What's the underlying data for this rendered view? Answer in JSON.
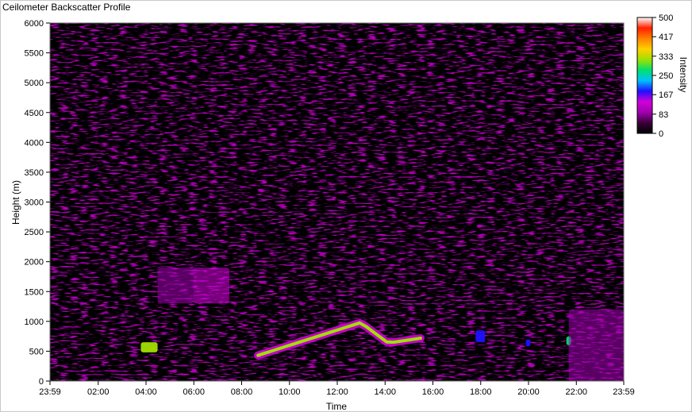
{
  "chart_data": {
    "type": "heatmap",
    "title": "Ceilometer Backscatter Profile",
    "xlabel": "Time",
    "ylabel": "Height (m)",
    "colorbar_label": "Intensity",
    "x_ticks": [
      "23:59",
      "02:00",
      "04:00",
      "06:00",
      "08:00",
      "10:00",
      "12:00",
      "14:00",
      "16:00",
      "18:00",
      "20:00",
      "22:00",
      "23:59"
    ],
    "x_tick_hours": [
      0,
      2.017,
      4.017,
      6.017,
      8.017,
      10.017,
      12.017,
      14.017,
      16.017,
      18.017,
      20.017,
      22.017,
      24
    ],
    "xlim_hours": [
      0,
      24
    ],
    "y_ticks": [
      0,
      500,
      1000,
      1500,
      2000,
      2500,
      3000,
      3500,
      4000,
      4500,
      5000,
      5500,
      6000
    ],
    "ylim": [
      0,
      6000
    ],
    "colorbar_ticks": [
      0,
      83,
      167,
      250,
      333,
      417,
      500
    ],
    "colorbar_range": [
      0,
      500
    ],
    "colormap": [
      "#000000",
      "#3a003a",
      "#a000b0",
      "#d000d8",
      "#2010ff",
      "#00c0ff",
      "#00e070",
      "#a0e000",
      "#ffd000",
      "#ff8000",
      "#ff2000",
      "#ffffff"
    ],
    "background_color": "#000000",
    "features": [
      {
        "name": "low cloud layer early",
        "hours": [
          3.8,
          4.5
        ],
        "height_m": [
          480,
          650
        ],
        "intensity": 300
      },
      {
        "name": "aerosol plume 04:30-06:00",
        "hours": [
          4.5,
          6.0
        ],
        "height_m": [
          1300,
          1900
        ],
        "intensity": 110
      },
      {
        "name": "aerosol plume 06:00-07:30",
        "hours": [
          6.0,
          7.5
        ],
        "height_m": [
          1300,
          1900
        ],
        "intensity": 120
      },
      {
        "name": "main cloud base arc",
        "hours": [
          8.7,
          15.5
        ],
        "height_m": [
          420,
          1050
        ],
        "intensity": 330
      },
      {
        "name": "isolated cloud 18:00",
        "hours": [
          17.8,
          18.2
        ],
        "height_m": [
          650,
          850
        ],
        "intensity": 200
      },
      {
        "name": "isolated cloud 20:00",
        "hours": [
          19.9,
          20.1
        ],
        "height_m": [
          580,
          700
        ],
        "intensity": 200
      },
      {
        "name": "cloud 21:40",
        "hours": [
          21.6,
          21.8
        ],
        "height_m": [
          600,
          750
        ],
        "intensity": 250
      },
      {
        "name": "precipitation / low fog",
        "hours": [
          21.7,
          24
        ],
        "height_m": [
          0,
          1200
        ],
        "intensity": 70
      }
    ]
  }
}
